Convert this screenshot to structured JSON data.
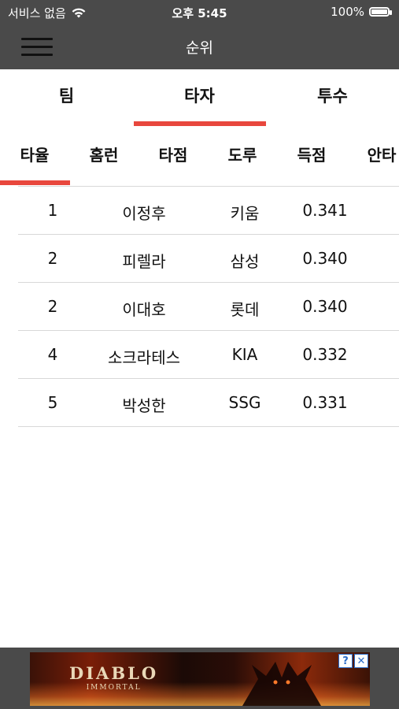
{
  "status_bar": {
    "carrier": "서비스 없음",
    "time": "오후 5:45",
    "battery": "100%"
  },
  "nav": {
    "title": "순위"
  },
  "primary_tabs": [
    {
      "label": "팀"
    },
    {
      "label": "타자",
      "selected": true
    },
    {
      "label": "투수"
    }
  ],
  "secondary_tabs": [
    {
      "label": "타율",
      "selected": true
    },
    {
      "label": "홈런"
    },
    {
      "label": "타점"
    },
    {
      "label": "도루"
    },
    {
      "label": "득점"
    },
    {
      "label": "안타"
    }
  ],
  "rankings": [
    {
      "rank": "1",
      "name": "이정후",
      "team": "키움",
      "value": "0.341"
    },
    {
      "rank": "2",
      "name": "피렐라",
      "team": "삼성",
      "value": "0.340"
    },
    {
      "rank": "2",
      "name": "이대호",
      "team": "롯데",
      "value": "0.340"
    },
    {
      "rank": "4",
      "name": "소크라테스",
      "team": "KIA",
      "value": "0.332"
    },
    {
      "rank": "5",
      "name": "박성한",
      "team": "SSG",
      "value": "0.331"
    }
  ],
  "ad": {
    "logo_line1": "DIABLO",
    "logo_line2": "IMMORTAL",
    "info_icon": "?",
    "close_icon": "✕"
  },
  "colors": {
    "accent": "#e8473d",
    "bar": "#4a4a4a"
  }
}
